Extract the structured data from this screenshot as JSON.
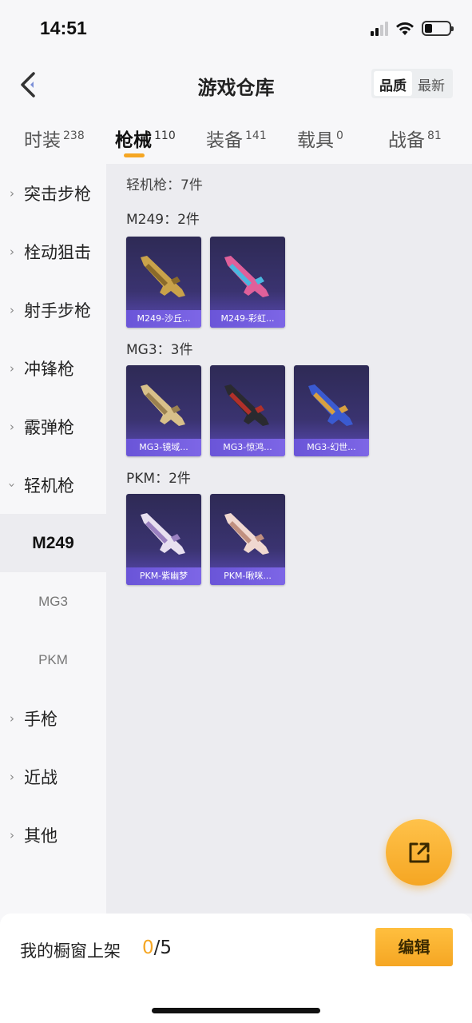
{
  "status_bar": {
    "time": "14:51",
    "battery_level": 0.3
  },
  "header": {
    "title": "游戏仓库",
    "sort_options": [
      "品质",
      "最新"
    ],
    "sort_selected": "品质"
  },
  "tabs": [
    {
      "label": "时装",
      "count": "238"
    },
    {
      "label": "枪械",
      "count": "110"
    },
    {
      "label": "装备",
      "count": "141"
    },
    {
      "label": "载具",
      "count": "0"
    },
    {
      "label": "战备",
      "count": "81"
    }
  ],
  "active_tab": "枪械",
  "sidebar": {
    "categories": [
      "突击步枪",
      "栓动狙击",
      "射手步枪",
      "冲锋枪",
      "霰弹枪",
      "轻机枪"
    ],
    "subcategories": [
      "M249",
      "MG3",
      "PKM"
    ],
    "more_categories": [
      "手枪",
      "近战",
      "其他"
    ],
    "active_subcategory": "M249"
  },
  "content": {
    "section_title": "轻机枪：7件",
    "groups": [
      {
        "title": "M249：2件",
        "items": [
          {
            "name": "M249-沙丘...",
            "colors": [
              "#c9a24a",
              "#8a6a2a"
            ]
          },
          {
            "name": "M249-彩虹...",
            "colors": [
              "#e0609a",
              "#4ab8e0"
            ]
          }
        ]
      },
      {
        "title": "MG3：3件",
        "items": [
          {
            "name": "MG3-镜域...",
            "colors": [
              "#d8c08a",
              "#9a8050"
            ]
          },
          {
            "name": "MG3-惊鸿...",
            "colors": [
              "#2a2a30",
              "#b0302a"
            ]
          },
          {
            "name": "MG3-幻世...",
            "colors": [
              "#3a5ad0",
              "#d8a040"
            ]
          }
        ]
      },
      {
        "title": "PKM：2件",
        "items": [
          {
            "name": "PKM-紫幽梦",
            "colors": [
              "#e8e0f0",
              "#9a80c0"
            ]
          },
          {
            "name": "PKM-啾咪...",
            "colors": [
              "#f0d8d0",
              "#c09080"
            ]
          }
        ]
      }
    ]
  },
  "bottom_bar": {
    "showcase_label": "我的橱窗上架",
    "showcase_current": "0",
    "showcase_separator": "/",
    "showcase_max": "5",
    "edit_label": "编辑"
  },
  "colors": {
    "accent": "#f5a623",
    "card_bg": "#2e2a55",
    "card_label": "#6a55d8"
  }
}
